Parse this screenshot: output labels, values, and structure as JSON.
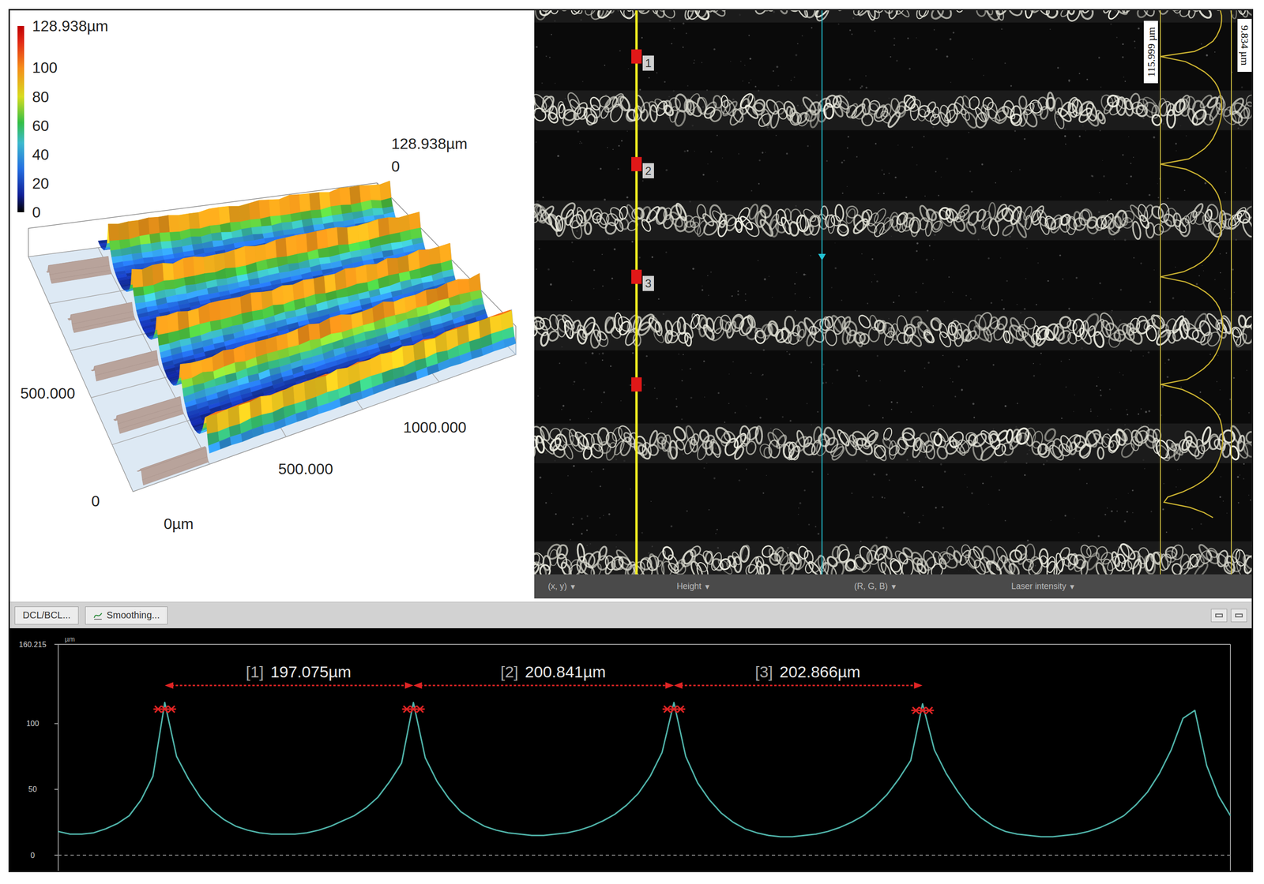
{
  "surface_view": {
    "colorbar": {
      "max_label": "128.938µm",
      "ticks": [
        "100",
        "80",
        "60",
        "40",
        "20",
        "0"
      ]
    },
    "labels": {
      "top": "128.938µm",
      "top_zero": "0",
      "depth_mid": "500.000",
      "x_far": "1000.000",
      "x_mid": "500.000",
      "origin_depth": "0",
      "origin_x": "0µm"
    }
  },
  "image_view": {
    "markers": [
      {
        "labeled": true,
        "label": "1"
      },
      {
        "labeled": true,
        "label": "2"
      },
      {
        "labeled": true,
        "label": "3"
      },
      {
        "labeled": false
      }
    ],
    "side_labels": [
      "115.999 µm",
      "9.834 µm"
    ],
    "toolbar": [
      {
        "label": "(x, y)",
        "arrow": "▾"
      },
      {
        "label": "Height",
        "arrow": "▾"
      },
      {
        "label": "(R, G, B)",
        "arrow": "▾"
      },
      {
        "label": "Laser intensity",
        "arrow": "▾"
      }
    ]
  },
  "toolbar": {
    "buttons": [
      {
        "label": "DCL/BCL..."
      },
      {
        "label": "Smoothing..."
      }
    ]
  },
  "profile_chart": {
    "unit": "µm",
    "y_ticks": [
      "160.215",
      "100",
      "50",
      "0"
    ],
    "values": [
      18,
      16,
      16,
      17,
      20,
      24,
      30,
      42,
      60,
      116,
      75,
      58,
      44,
      34,
      27,
      22,
      19,
      17,
      16,
      16,
      16,
      17,
      19,
      22,
      26,
      30,
      36,
      44,
      56,
      70,
      116,
      74,
      56,
      43,
      33,
      27,
      22,
      19,
      17,
      16,
      15,
      15,
      16,
      17,
      19,
      22,
      26,
      31,
      38,
      47,
      60,
      78,
      116,
      75,
      55,
      42,
      32,
      25,
      20,
      17,
      15,
      14,
      14,
      15,
      16,
      18,
      21,
      25,
      30,
      37,
      46,
      58,
      72,
      115,
      80,
      62,
      48,
      36,
      28,
      22,
      18,
      16,
      15,
      14,
      14,
      15,
      16,
      18,
      21,
      25,
      30,
      38,
      48,
      62,
      80,
      104,
      110,
      68,
      45,
      30
    ],
    "measurements": [
      {
        "index": "[1]",
        "value": "197.075µm"
      },
      {
        "index": "[2]",
        "value": "200.841µm"
      },
      {
        "index": "[3]",
        "value": "202.866µm"
      }
    ]
  }
}
